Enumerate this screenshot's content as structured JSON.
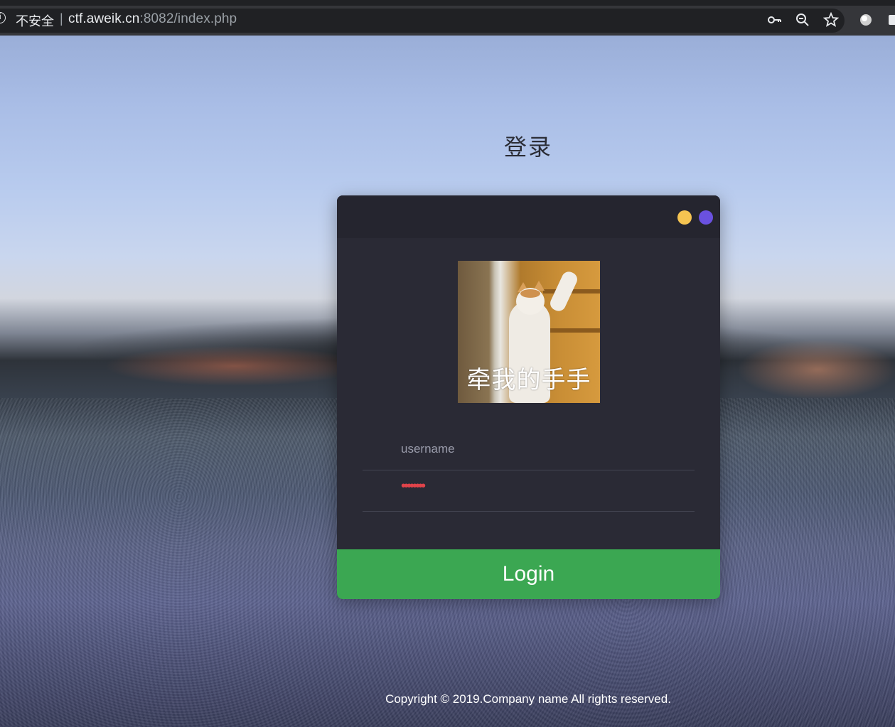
{
  "browser": {
    "security_label": "不安全",
    "separator": "|",
    "url_host": "ctf.aweik.cn",
    "url_rest": ":8082/index.php"
  },
  "page": {
    "title": "登录"
  },
  "login_card": {
    "dot_colors": [
      "#f5c451",
      "#6a51e0"
    ],
    "avatar_caption": "牵我的手手",
    "username_placeholder": "username",
    "password_masked": "••••••••",
    "login_label": "Login"
  },
  "footer": {
    "copyright": "Copyright © 2019.Company name All rights reserved."
  },
  "colors": {
    "login_button": "#3ba752",
    "card_background": "#2a2a35"
  }
}
